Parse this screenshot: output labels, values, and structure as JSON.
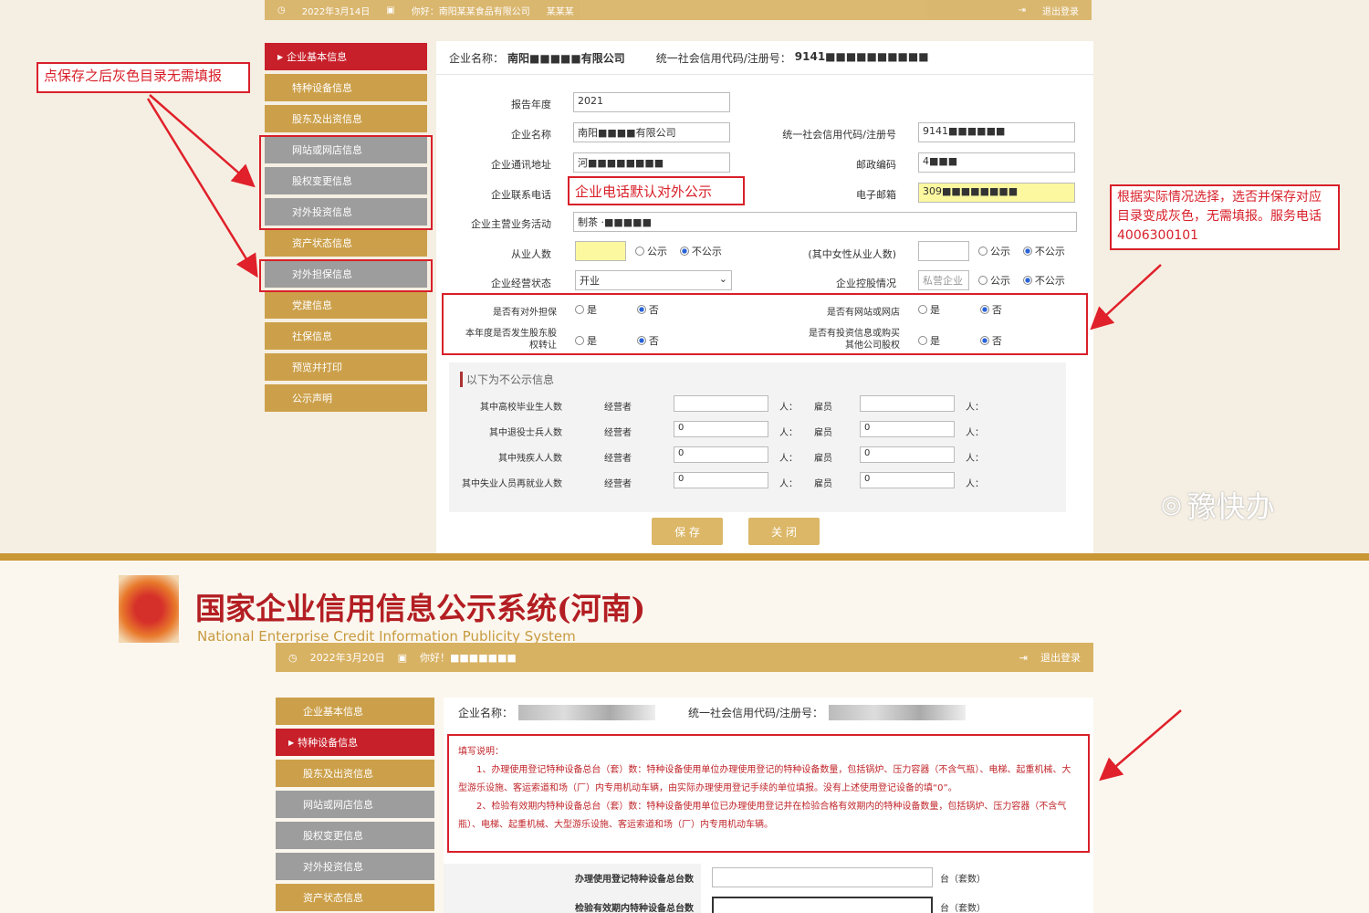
{
  "top": {
    "date": "2022年3月14日",
    "user": "你好：南阳某某食品有限公司",
    "status": "某某某",
    "logout": "退出登录",
    "company_label": "企业名称：",
    "company_value": "南阳■■■■■有限公司",
    "credit_label": "统一社会信用代码/注册号：",
    "credit_value": "9141■■■■■■■■■■"
  },
  "menu_top": [
    {
      "label": "企业基本信息",
      "state": "active"
    },
    {
      "label": "特种设备信息",
      "state": "normal"
    },
    {
      "label": "股东及出资信息",
      "state": "normal"
    },
    {
      "label": "网站或网店信息",
      "state": "gray"
    },
    {
      "label": "股权变更信息",
      "state": "gray"
    },
    {
      "label": "对外投资信息",
      "state": "gray"
    },
    {
      "label": "资产状态信息",
      "state": "normal"
    },
    {
      "label": "对外担保信息",
      "state": "gray"
    },
    {
      "label": "党建信息",
      "state": "normal"
    },
    {
      "label": "社保信息",
      "state": "normal"
    },
    {
      "label": "预览并打印",
      "state": "normal"
    },
    {
      "label": "公示声明",
      "state": "normal"
    }
  ],
  "form": {
    "year_label": "报告年度",
    "year_value": "2021",
    "name_label": "企业名称",
    "name_value": "南阳■■■■有限公司",
    "credit_label": "统一社会信用代码/注册号",
    "credit_value": "9141■■■■■■",
    "address_label": "企业通讯地址",
    "address_value": "河■■■■■■■■",
    "postcode_label": "邮政编码",
    "postcode_value": "4■■■",
    "phone_label": "企业联系电话",
    "phone_value": "企业电话默认对外公示",
    "email_label": "电子邮箱",
    "email_value": "309■■■■■■■■",
    "business_label": "企业主营业务活动",
    "business_value": "制茶 ·■■■■■",
    "employees_label": "从业人数",
    "women_label": "(其中女性从业人数)",
    "public": "公示",
    "not_public": "不公示",
    "status_label": "企业经营状态",
    "status_value": "开业",
    "holding_label": "企业控股情况",
    "holding_value": "私营企业",
    "q1": "是否有对外担保",
    "q2": "是否有网站或网店",
    "q3": "本年度是否发生股东股权转让",
    "q4": "是否有投资信息或购买其他公司股权",
    "yes": "是",
    "no": "否",
    "nonpublic_title": "以下为不公示信息",
    "rows": [
      {
        "label": "其中高校毕业生人数",
        "op": "",
        "emp": ""
      },
      {
        "label": "其中退役士兵人数",
        "op": "0",
        "emp": "0"
      },
      {
        "label": "其中残疾人人数",
        "op": "0",
        "emp": "0"
      },
      {
        "label": "其中失业人员再就业人数",
        "op": "0",
        "emp": "0"
      }
    ],
    "operator": "经营者",
    "employee": "雇员",
    "unit": "人：",
    "save": "保 存",
    "close": "关 闭"
  },
  "annotations": {
    "left": "点保存之后灰色目录无需填报",
    "right": "根据实际情况选择，选否并保存对应目录变成灰色，无需填报。服务电话4006300101"
  },
  "watermark": "豫快办",
  "bottom": {
    "title_cn": "国家企业信用信息公示系统(河南)",
    "title_en": "National Enterprise Credit Information Publicity System",
    "date": "2022年3月20日",
    "user": "你好！■■■■■■■",
    "logout": "退出登录",
    "company_label": "企业名称：",
    "credit_label": "统一社会信用代码/注册号：",
    "menu": [
      {
        "label": "企业基本信息",
        "state": "normal"
      },
      {
        "label": "特种设备信息",
        "state": "active"
      },
      {
        "label": "股东及出资信息",
        "state": "normal"
      },
      {
        "label": "网站或网店信息",
        "state": "gray"
      },
      {
        "label": "股权变更信息",
        "state": "gray"
      },
      {
        "label": "对外投资信息",
        "state": "gray"
      },
      {
        "label": "资产状态信息",
        "state": "normal"
      }
    ],
    "note_title": "填写说明：",
    "note1": "1、办理使用登记特种设备总台（套）数：特种设备使用单位办理使用登记的特种设备数量，包括锅炉、压力容器（不含气瓶）、电梯、起重机械、大型游乐设施、客运索道和场（厂）内专用机动车辆，由实际办理使用登记手续的单位填报。没有上述使用登记设备的填“0”。",
    "note2": "2、检验有效期内特种设备总台（套）数：特种设备使用单位已办理使用登记并在检验合格有效期内的特种设备数量，包括锅炉、压力容器（不含气瓶）、电梯、起重机械、大型游乐设施、客运索道和场（厂）内专用机动车辆。",
    "field1": "办理使用登记特种设备总台数",
    "field2": "检验有效期内特种设备总台数",
    "unit": "台（套数）"
  }
}
